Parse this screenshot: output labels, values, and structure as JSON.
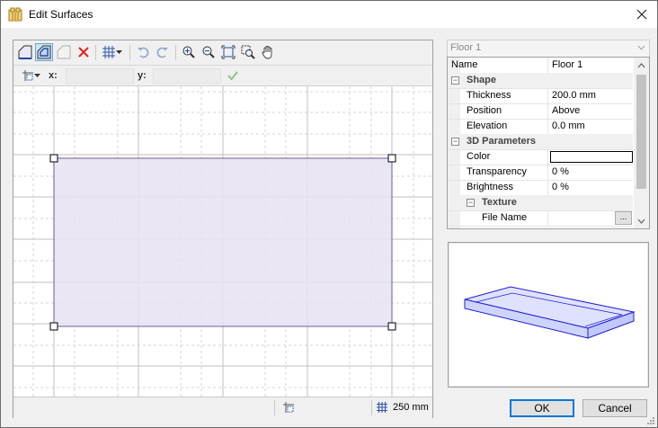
{
  "window": {
    "title": "Edit Surfaces"
  },
  "toolbar": {
    "coord_x_label": "x:",
    "coord_y_label": "y:",
    "coord_x_value": "",
    "coord_y_value": ""
  },
  "statusbar": {
    "grid_size": "250 mm"
  },
  "selector": {
    "selected": "Floor 1"
  },
  "properties": {
    "name_label": "Name",
    "name_value": "Floor 1",
    "shape_category": "Shape",
    "thickness_label": "Thickness",
    "thickness_value": "200.0 mm",
    "position_label": "Position",
    "position_value": "Above",
    "elevation_label": "Elevation",
    "elevation_value": "0.0 mm",
    "params_category": "3D Parameters",
    "color_label": "Color",
    "transparency_label": "Transparency",
    "transparency_value": "0 %",
    "brightness_label": "Brightness",
    "brightness_value": "0 %",
    "texture_category": "Texture",
    "filename_label": "File Name",
    "filename_button": "..."
  },
  "buttons": {
    "ok": "OK",
    "cancel": "Cancel"
  },
  "colors": {
    "surface_fill": "#e8e2f2",
    "surface_border": "#6b5a9a",
    "preview_outline": "#2020d0",
    "preview_fill": "#cfd4ff"
  }
}
